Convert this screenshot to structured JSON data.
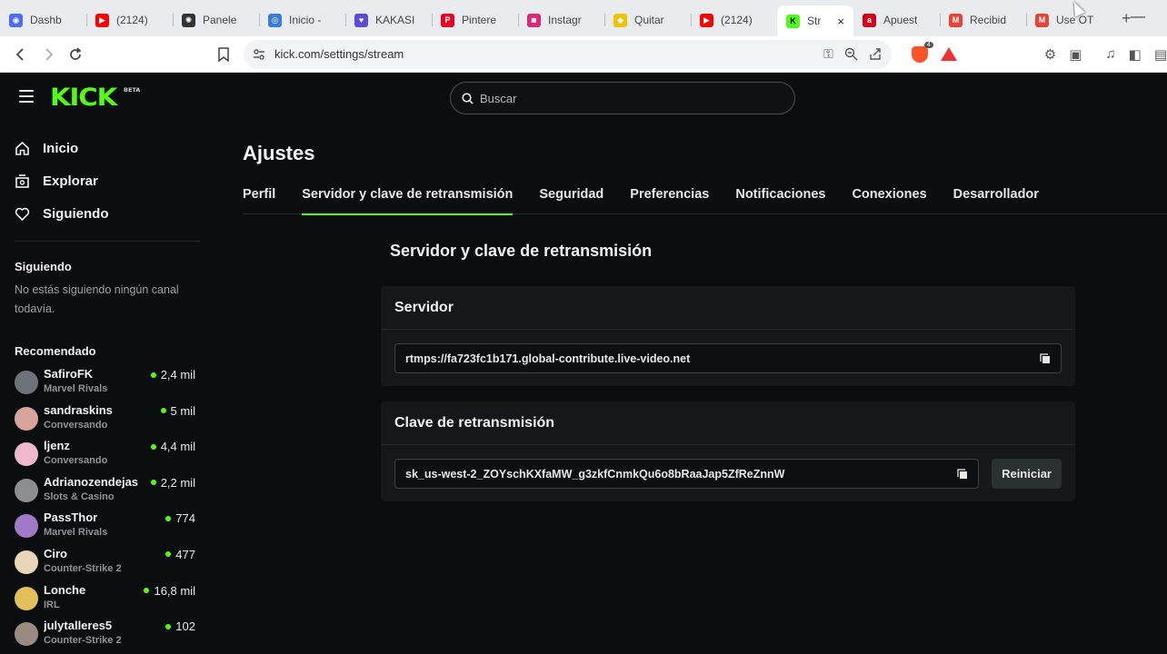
{
  "browser": {
    "tabs": [
      {
        "title": "Dashb",
        "color": "#4a6cf7",
        "glyph": "◉"
      },
      {
        "title": "(2124)",
        "color": "#ff0000",
        "glyph": "▶"
      },
      {
        "title": "Panele",
        "color": "#333333",
        "glyph": "✺"
      },
      {
        "title": "Inicio -",
        "color": "#3a7bd5",
        "glyph": "◎"
      },
      {
        "title": "KAKASI",
        "color": "#5b4bd6",
        "glyph": "♥"
      },
      {
        "title": "Pintere",
        "color": "#e60023",
        "glyph": "P"
      },
      {
        "title": "Instagr",
        "color": "#d62976",
        "glyph": "◙"
      },
      {
        "title": "Quitar",
        "color": "#f2c200",
        "glyph": "◆"
      },
      {
        "title": "(2124)",
        "color": "#ff0000",
        "glyph": "▶"
      },
      {
        "title": "Str",
        "color": "#53fc18",
        "glyph": "K",
        "active": true,
        "close": "×"
      },
      {
        "title": "Apuest",
        "color": "#d0021b",
        "glyph": "a"
      },
      {
        "title": "Recibid",
        "color": "#ea4335",
        "glyph": "M"
      },
      {
        "title": "Use OT",
        "color": "#ea4335",
        "glyph": "M"
      }
    ],
    "new_tab": "+",
    "minimize": "—",
    "url": "kick.com/settings/stream",
    "shield_badge": "4"
  },
  "app": {
    "logo": "KICK",
    "logo_badge": "BETA",
    "search_placeholder": "Buscar"
  },
  "sidebar": {
    "nav": [
      {
        "label": "Inicio",
        "icon": "home-icon"
      },
      {
        "label": "Explorar",
        "icon": "compass-icon"
      },
      {
        "label": "Siguiendo",
        "icon": "heart-icon"
      }
    ],
    "following_title": "Siguiendo",
    "following_empty": "No estás siguiendo ningún canal todavía.",
    "recommended_title": "Recomendado",
    "channels": [
      {
        "name": "SafiroFK",
        "category": "Marvel Rivals",
        "viewers": "2,4 mil",
        "avatar_color": "#6d7378"
      },
      {
        "name": "sandraskins",
        "category": "Conversando",
        "viewers": "5 mil",
        "avatar_color": "#d7a59a"
      },
      {
        "name": "ljenz",
        "category": "Conversando",
        "viewers": "4,4 mil",
        "avatar_color": "#f0b8cf"
      },
      {
        "name": "Adrianozendejas",
        "category": "Slots & Casino",
        "viewers": "2,2 mil",
        "avatar_color": "#8c8f92"
      },
      {
        "name": "PassThor",
        "category": "Marvel Rivals",
        "viewers": "774",
        "avatar_color": "#a079c7"
      },
      {
        "name": "Ciro",
        "category": "Counter-Strike 2",
        "viewers": "477",
        "avatar_color": "#e9d6b8"
      },
      {
        "name": "Lonche",
        "category": "IRL",
        "viewers": "16,8 mil",
        "avatar_color": "#e2c15a"
      },
      {
        "name": "julytalleres5",
        "category": "Counter-Strike 2",
        "viewers": "102",
        "avatar_color": "#9b8a7f"
      }
    ]
  },
  "settings": {
    "title": "Ajustes",
    "tabs": [
      {
        "label": "Perfil"
      },
      {
        "label": "Servidor y clave de retransmisión",
        "active": true
      },
      {
        "label": "Seguridad"
      },
      {
        "label": "Preferencias"
      },
      {
        "label": "Notificaciones"
      },
      {
        "label": "Conexiones"
      },
      {
        "label": "Desarrollador"
      }
    ],
    "section_title": "Servidor y clave de retransmisión",
    "server": {
      "heading": "Servidor",
      "value": "rtmps://fa723fc1b171.global-contribute.live-video.net"
    },
    "key": {
      "heading": "Clave de retransmisión",
      "value": "sk_us-west-2_ZOYschKXfaMW_g3zkfCnmkQu6o8bRaaJap5ZfReZnnW",
      "reset_label": "Reiniciar"
    }
  },
  "colors": {
    "accent": "#53fc18",
    "background": "#0b0e0f",
    "card": "#14181a"
  }
}
